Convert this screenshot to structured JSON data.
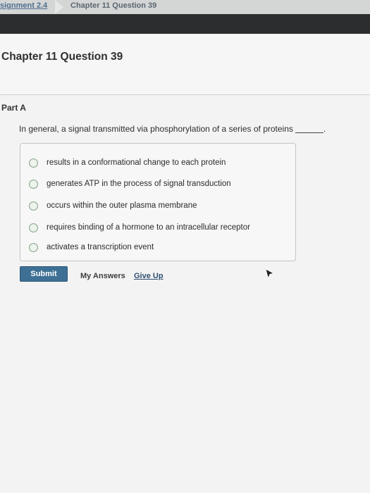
{
  "tabs": [
    "signment 2.4",
    "Chapter 11 Question 39"
  ],
  "page_title": "Chapter 11 Question 39",
  "part_label": "Part A",
  "question_text": "In general, a signal transmitted via phosphorylation of a series of proteins",
  "question_suffix": ".",
  "choices": [
    "results in a conformational change to each protein",
    "generates ATP in the process of signal transduction",
    "occurs within the outer plasma membrane",
    "requires binding of a hormone to an intracellular receptor",
    "activates a transcription event"
  ],
  "buttons": {
    "submit": "Submit",
    "my_answers": "My Answers",
    "give_up": "Give Up"
  },
  "colors": {
    "submit_bg": "#3e7095",
    "link": "#2f4f6f",
    "dark_bar": "#2c2d2f"
  }
}
